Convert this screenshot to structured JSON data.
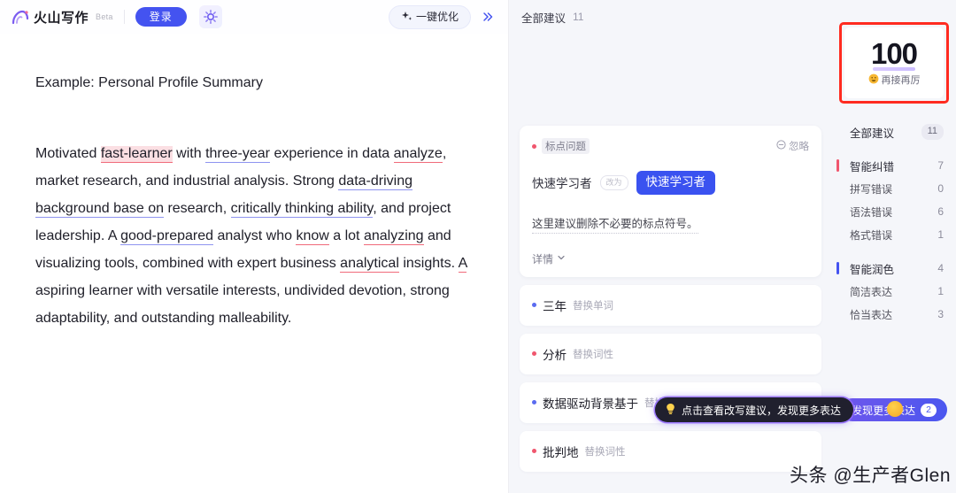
{
  "header": {
    "brand_name": "火山写作",
    "beta_tag": "Beta",
    "login_label": "登录",
    "magic_icon": "magic-wand-icon",
    "optimize_label": "一键优化",
    "optimize_icon": "sparkle-icon",
    "collapse_icon": "chevron-double-right-icon"
  },
  "document": {
    "title": "Example: Personal Profile Summary",
    "paragraph": [
      {
        "text": "Motivated ",
        "mark": "none"
      },
      {
        "text": "fast-learner",
        "mark": "red-highlight"
      },
      {
        "text": " with ",
        "mark": "none"
      },
      {
        "text": "three-year",
        "mark": "blue"
      },
      {
        "text": " experience in data ",
        "mark": "none"
      },
      {
        "text": "analyze",
        "mark": "red"
      },
      {
        "text": ", market research, and industrial analysis. Strong ",
        "mark": "none"
      },
      {
        "text": "data-driving background base on",
        "mark": "blue"
      },
      {
        "text": " research, ",
        "mark": "none"
      },
      {
        "text": "critically thinking ability",
        "mark": "blue"
      },
      {
        "text": ", and project leadership. A ",
        "mark": "none"
      },
      {
        "text": "good-prepared",
        "mark": "blue"
      },
      {
        "text": " analyst who ",
        "mark": "none"
      },
      {
        "text": "know",
        "mark": "red"
      },
      {
        "text": " a lot ",
        "mark": "none"
      },
      {
        "text": "analyzing",
        "mark": "red"
      },
      {
        "text": " and visualizing tools, combined with expert business ",
        "mark": "none"
      },
      {
        "text": "analytical",
        "mark": "red"
      },
      {
        "text": " insights. ",
        "mark": "none"
      },
      {
        "text": "A",
        "mark": "red"
      },
      {
        "text": " aspiring learner with versatile interests, undivided devotion, strong adaptability, and outstanding malleability.",
        "mark": "none"
      }
    ]
  },
  "suggestions_panel": {
    "header_label": "全部建议",
    "header_count": "11",
    "card": {
      "tag": "标点问题",
      "ignore_label": "忽略",
      "ignore_icon": "circle-minus-icon",
      "original": "快速学习者",
      "arrow_badge": "改为",
      "replacement": "快速学习者",
      "description": "这里建议删除不必要的标点符号。",
      "detail_label": "详情",
      "detail_icon": "chevron-down-icon"
    },
    "items": [
      {
        "word": "三年",
        "kind": "替换单词",
        "dot": "blue"
      },
      {
        "word": "分析",
        "kind": "替换词性",
        "dot": "red"
      },
      {
        "word": "数据驱动背景基于",
        "kind": "替换",
        "dot": "blue"
      },
      {
        "word": "批判地",
        "kind": "替换词性",
        "dot": "red"
      }
    ]
  },
  "tooltip": {
    "icon": "lightbulb-icon",
    "text": "点击查看改写建议，发现更多表达"
  },
  "sidebar": {
    "score": {
      "value": "100",
      "emoji": "grinning-face-emoji",
      "caption": "再接再厉"
    },
    "all_label": "全部建议",
    "all_count": "11",
    "groups": [
      {
        "name": "智能纠错",
        "count": "7",
        "accent": "red",
        "children": [
          {
            "name": "拼写错误",
            "count": "0"
          },
          {
            "name": "语法错误",
            "count": "6"
          },
          {
            "name": "格式错误",
            "count": "1"
          }
        ]
      },
      {
        "name": "智能润色",
        "count": "4",
        "accent": "blue",
        "children": [
          {
            "name": "简洁表达",
            "count": "1"
          },
          {
            "name": "恰当表达",
            "count": "3"
          }
        ]
      }
    ],
    "discover": {
      "label": "发现更多表达",
      "badge": "2"
    }
  },
  "watermark": "头条 @生产者Glen",
  "colors": {
    "primary": "#4453f0",
    "error": "#f0566e",
    "polish": "#4453f0",
    "highlight_box": "#ff2b20"
  }
}
